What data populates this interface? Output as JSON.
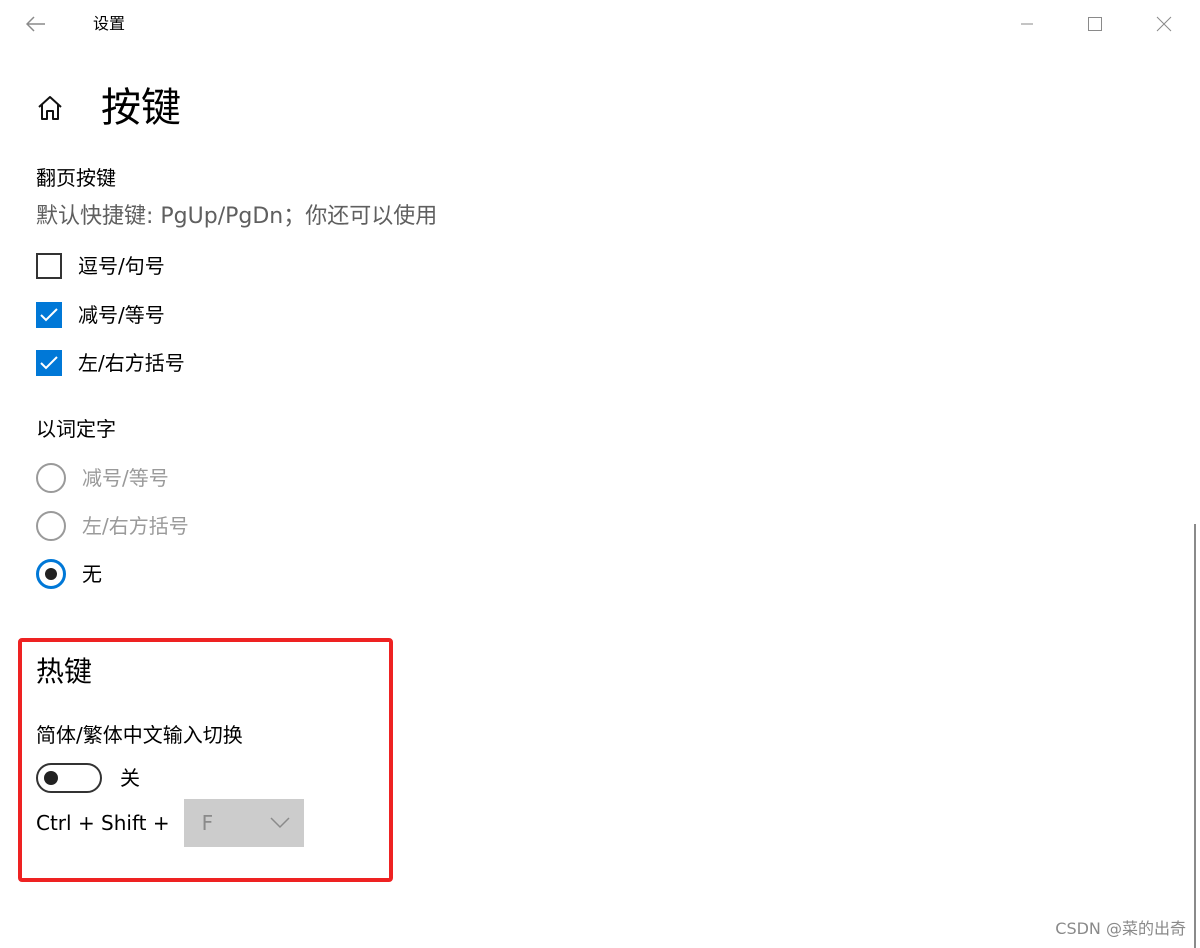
{
  "window": {
    "title": "设置"
  },
  "page": {
    "title": "按键"
  },
  "page_keys": {
    "label": "翻页按键",
    "description": "默认快捷键: PgUp/PgDn；你还可以使用",
    "options": [
      {
        "label": "逗号/句号",
        "checked": false
      },
      {
        "label": "减号/等号",
        "checked": true
      },
      {
        "label": "左/右方括号",
        "checked": true
      }
    ]
  },
  "word_select": {
    "label": "以词定字",
    "options": [
      {
        "label": "减号/等号",
        "selected": false,
        "disabled": true
      },
      {
        "label": "左/右方括号",
        "selected": false,
        "disabled": true
      },
      {
        "label": "无",
        "selected": true,
        "disabled": false
      }
    ]
  },
  "hotkeys": {
    "title": "热键",
    "switch_label": "简体/繁体中文输入切换",
    "toggle_state": "关",
    "toggle_on": false,
    "combo_prefix": "Ctrl + Shift +",
    "combo_value": "F"
  },
  "watermark": "CSDN @菜的出奇",
  "colors": {
    "accent": "#0078d7",
    "highlight_border": "#ee2222",
    "disabled_text": "#9a9a9a",
    "dropdown_bg": "#cccccc"
  },
  "icons": {
    "back": "back-arrow-icon",
    "home": "home-icon",
    "minimize": "minimize-icon",
    "maximize": "maximize-icon",
    "close": "close-icon",
    "dropdown": "chevron-down-icon",
    "check": "checkmark-icon"
  }
}
